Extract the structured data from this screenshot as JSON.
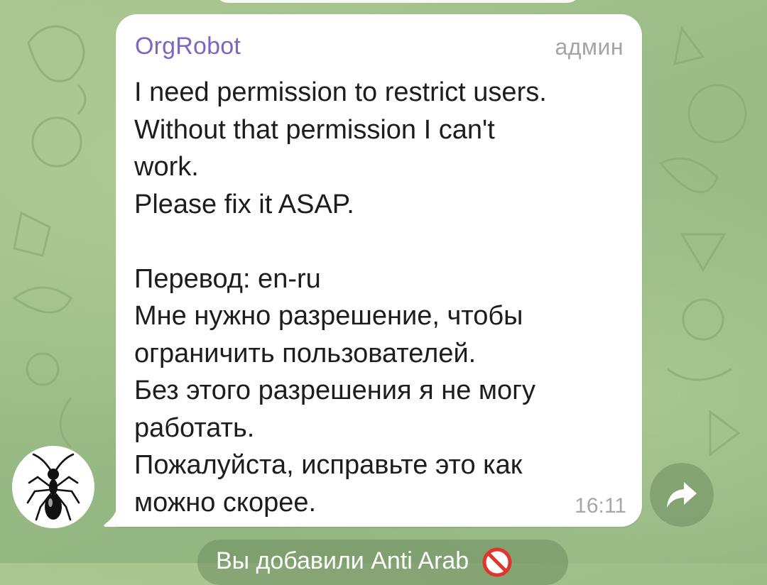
{
  "message": {
    "sender": "OrgRobot",
    "role": "админ",
    "lines": [
      "I need permission to restrict users.",
      "Without that permission I can't",
      "work.",
      "Please fix it ASAP.",
      "",
      "Перевод: en-ru",
      "Мне нужно разрешение, чтобы",
      "ограничить пользователей.",
      "Без этого разрешения я не могу",
      "работать.",
      "Пожалуйста, исправьте это как",
      "можно скорее."
    ],
    "time": "16:11"
  },
  "avatar": {
    "icon": "ant-icon"
  },
  "forward": {
    "icon": "forward-arrow-icon"
  },
  "service_message": {
    "text": "Вы добавили Anti Arab",
    "icon": "no-entry-icon"
  },
  "colors": {
    "sender_name": "#7b67c0",
    "chat_background": "#9fc08a",
    "bubble": "#ffffff",
    "meta_text": "#a4a4a4"
  }
}
